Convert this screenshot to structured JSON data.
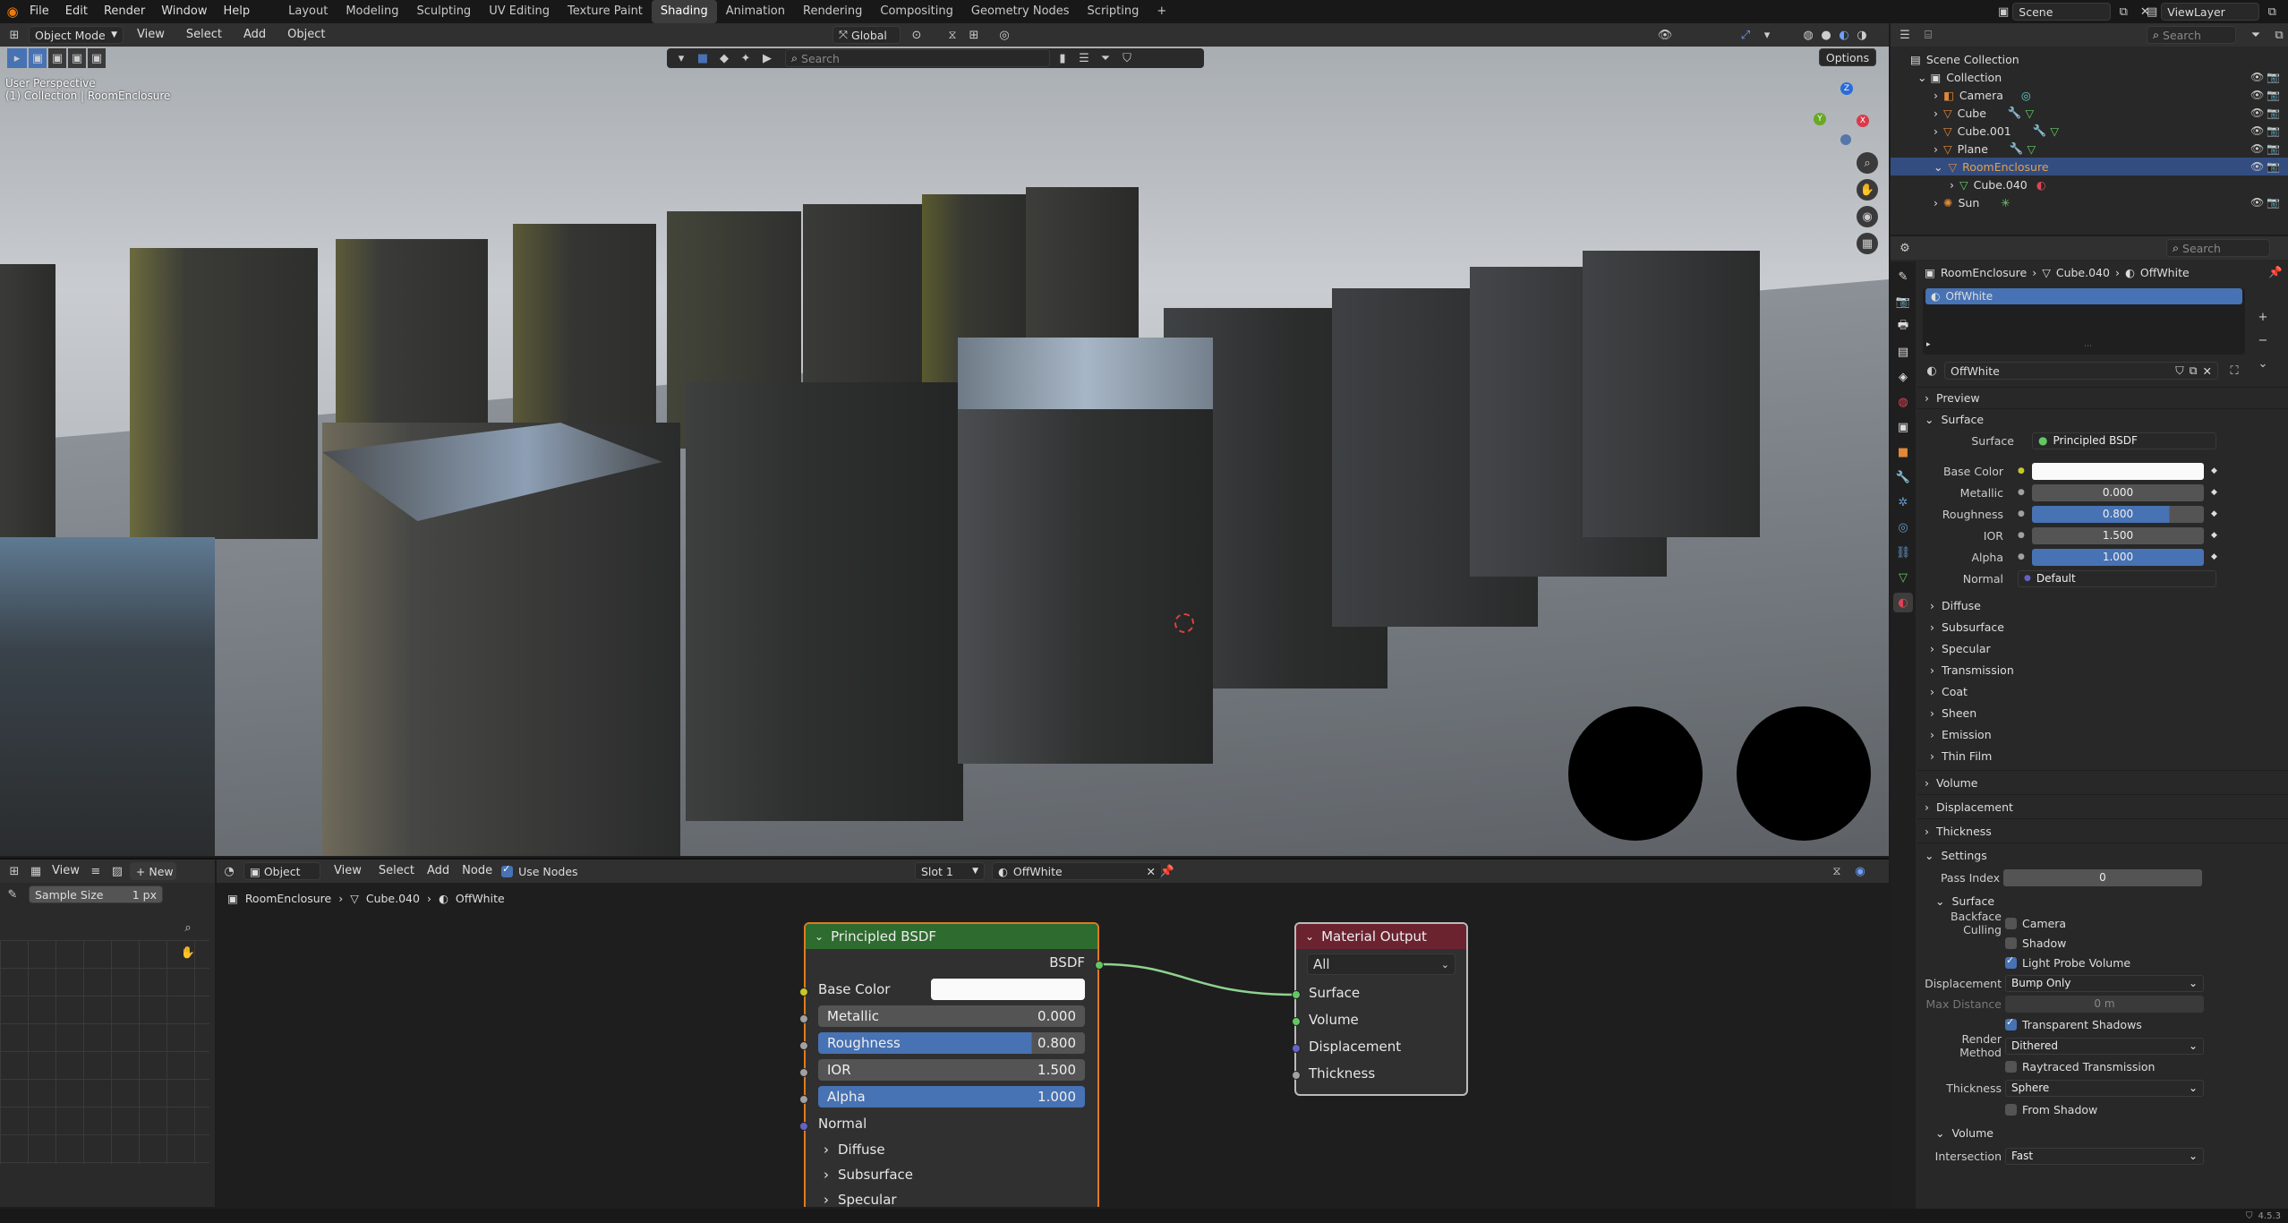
{
  "menu": [
    "File",
    "Edit",
    "Render",
    "Window",
    "Help"
  ],
  "workspaces": [
    "Layout",
    "Modeling",
    "Sculpting",
    "UV Editing",
    "Texture Paint",
    "Shading",
    "Animation",
    "Rendering",
    "Compositing",
    "Geometry Nodes",
    "Scripting"
  ],
  "active_workspace": "Shading",
  "add_workspace": "+",
  "scene": "Scene",
  "view_layer": "ViewLayer",
  "viewport": {
    "mode": "Object Mode",
    "menus": [
      "View",
      "Select",
      "Add",
      "Object"
    ],
    "transform": "Global",
    "options": "Options",
    "search_placeholder": "Search",
    "overlay_line1": "User Perspective",
    "overlay_line2": "(1) Collection | RoomEnclosure"
  },
  "outliner": {
    "search_placeholder": "Search",
    "scene_collection": "Scene Collection",
    "collection": "Collection",
    "items": [
      {
        "name": "Camera",
        "type": "camera"
      },
      {
        "name": "Cube",
        "type": "mesh"
      },
      {
        "name": "Cube.001",
        "type": "mesh"
      },
      {
        "name": "Plane",
        "type": "mesh"
      },
      {
        "name": "RoomEnclosure",
        "type": "mesh",
        "selected": true
      },
      {
        "name": "Cube.040",
        "type": "child"
      },
      {
        "name": "Sun",
        "type": "light"
      }
    ]
  },
  "properties": {
    "search_placeholder": "Search",
    "breadcrumb": [
      "RoomEnclosure",
      "Cube.040",
      "OffWhite"
    ],
    "slot_name": "OffWhite",
    "material_name": "OffWhite",
    "panels_top": [
      "Preview",
      "Surface"
    ],
    "surface_label": "Surface",
    "surface_value": "Principled BSDF",
    "fields": [
      {
        "label": "Base Color",
        "value": ""
      },
      {
        "label": "Metallic",
        "value": "0.000"
      },
      {
        "label": "Roughness",
        "value": "0.800"
      },
      {
        "label": "IOR",
        "value": "1.500"
      },
      {
        "label": "Alpha",
        "value": "1.000"
      }
    ],
    "normal_label": "Normal",
    "normal_value": "Default",
    "subpanels": [
      "Diffuse",
      "Subsurface",
      "Specular",
      "Transmission",
      "Coat",
      "Sheen",
      "Emission",
      "Thin Film"
    ],
    "panels_bottom": [
      "Volume",
      "Displacement",
      "Thickness",
      "Settings"
    ],
    "pass_index_label": "Pass Index",
    "pass_index": "0",
    "settings_surface": "Surface",
    "backface_culling": "Backface Culling",
    "camera": "Camera",
    "shadow": "Shadow",
    "light_probe_volume": "Light Probe Volume",
    "displacement_label": "Displacement",
    "displacement_value": "Bump Only",
    "max_distance_label": "Max Distance",
    "max_distance": "0 m",
    "transparent_shadows": "Transparent Shadows",
    "render_method_label": "Render Method",
    "render_method": "Dithered",
    "raytraced_transmission": "Raytraced Transmission",
    "thickness_label": "Thickness",
    "thickness_value": "Sphere",
    "from_shadow": "From Shadow",
    "volume_sub": "Volume",
    "intersection_label": "Intersection",
    "intersection_value": "Fast"
  },
  "image_editor": {
    "view": "View",
    "new": "New",
    "sample_size_label": "Sample Size",
    "sample_size": "1 px"
  },
  "node_editor": {
    "object": "Object",
    "menus": [
      "View",
      "Select",
      "Add",
      "Node"
    ],
    "use_nodes": "Use Nodes",
    "slot": "Slot 1",
    "material": "OffWhite",
    "breadcrumb": [
      "RoomEnclosure",
      "Cube.040",
      "OffWhite"
    ]
  },
  "bsdf_node": {
    "title": "Principled BSDF",
    "output": "BSDF",
    "base_color": "Base Color",
    "metallic": "Metallic",
    "metallic_value": "0.000",
    "roughness": "Roughness",
    "roughness_value": "0.800",
    "ior": "IOR",
    "ior_value": "1.500",
    "alpha": "Alpha",
    "alpha_value": "1.000",
    "normal": "Normal",
    "sub": [
      "Diffuse",
      "Subsurface",
      "Specular"
    ]
  },
  "output_node": {
    "title": "Material Output",
    "target": "All",
    "inputs": [
      "Surface",
      "Volume",
      "Displacement",
      "Thickness"
    ]
  },
  "status": {
    "version": "4.5.3"
  },
  "colors": {
    "accent": "#4772b3",
    "selected_row": "#334d80",
    "bsdf_header": "#2e6b2e",
    "output_header": "#6b2330"
  }
}
